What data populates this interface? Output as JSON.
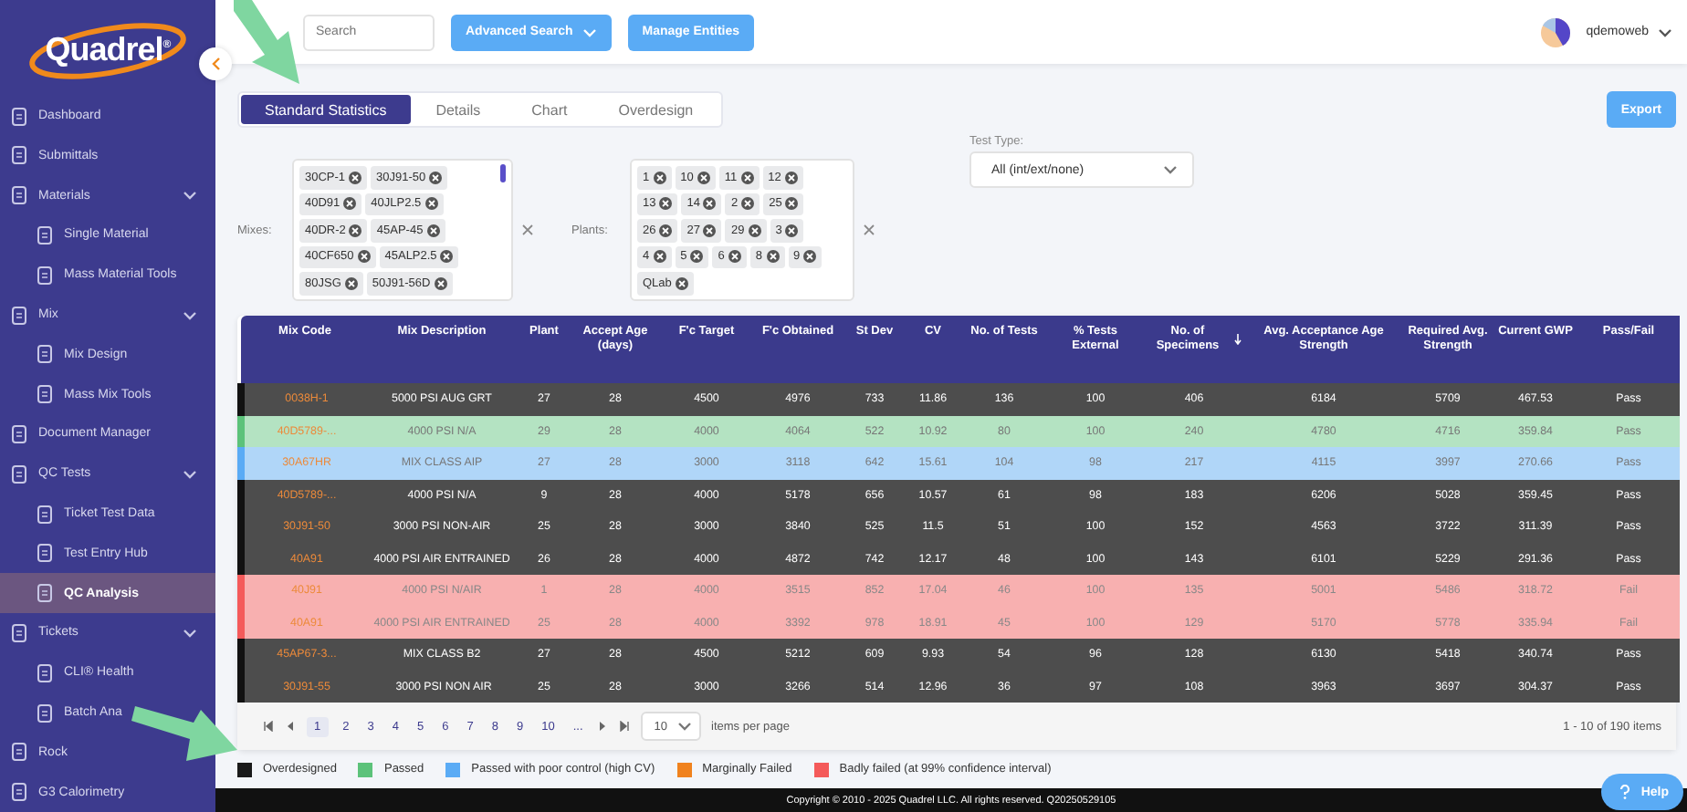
{
  "sidebar": {
    "logo": "Quadrel$^{®}$",
    "items": [
      {
        "label": "Dashboard",
        "selected": false
      },
      {
        "label": "Submittals",
        "selected": false
      },
      {
        "label": "Materials",
        "selected": false,
        "expanded": true,
        "children": [
          {
            "label": "Single Material",
            "selected": false
          },
          {
            "label": "Mass Material Tools",
            "selected": false
          }
        ]
      },
      {
        "label": "Mix",
        "selected": false,
        "expanded": true,
        "children": [
          {
            "label": "Mix Design",
            "selected": false
          },
          {
            "label": "Mass Mix Tools",
            "selected": false
          }
        ]
      },
      {
        "label": "Document Manager",
        "selected": false
      },
      {
        "label": "QC Tests",
        "selected": false,
        "expanded": true,
        "children": [
          {
            "label": "Ticket Test Data",
            "selected": false
          },
          {
            "label": "Test Entry Hub",
            "selected": false
          },
          {
            "label": "QC Analysis",
            "selected": true
          }
        ]
      },
      {
        "label": "Tickets",
        "selected": false,
        "expanded": true,
        "children": [
          {
            "label": "CLI® Health",
            "selected": false
          },
          {
            "label": "Batch Ana",
            "selected": false
          }
        ]
      },
      {
        "label": "Rock",
        "selected": false
      },
      {
        "label": "G3 Calorimetry",
        "selected": false
      }
    ]
  },
  "topbar": {
    "search": {
      "placeholder": "Search"
    },
    "buttons": [
      {
        "label": "Advanced Search",
        "kind": "dropdown"
      },
      {
        "label": "Manage Entities",
        "kind": "plain"
      }
    ],
    "user": "qdemoweb"
  },
  "tabs": [
    {
      "label": "Standard Statistics",
      "selected": true
    },
    {
      "label": "Details",
      "selected": false
    },
    {
      "label": "Chart",
      "selected": false
    },
    {
      "label": "Overdesign",
      "selected": false
    }
  ],
  "export_button": "Export",
  "filters": {
    "mixes": {
      "label": "Mixes:",
      "chips": [
        "30CP-1",
        "30J91-50",
        "40D91",
        "40JLP2.5",
        "40DR-2",
        "45AP-45",
        "40CF650",
        "45ALP2.5",
        "80JSG",
        "50J91-56D"
      ]
    },
    "plants": {
      "label": "Plants:",
      "chips": [
        "1",
        "10",
        "11",
        "12",
        "13",
        "14",
        "2",
        "25",
        "26",
        "27",
        "29",
        "3",
        "4",
        "5",
        "6",
        "8",
        "9",
        "QLab"
      ]
    },
    "test_type": {
      "label": "Test Type:",
      "value": "All (int/ext/none)"
    }
  },
  "table": {
    "columns": [
      {
        "label": "Mix Code",
        "sorted": false
      },
      {
        "label": "Mix Description",
        "sorted": false
      },
      {
        "label": "Plant",
        "sorted": false
      },
      {
        "label": "Accept Age (days)",
        "sorted": false
      },
      {
        "label": "F'c Target",
        "sorted": false
      },
      {
        "label": "F'c Obtained",
        "sorted": false
      },
      {
        "label": "St Dev",
        "sorted": false
      },
      {
        "label": "CV",
        "sorted": false
      },
      {
        "label": "No. of Tests",
        "sorted": false
      },
      {
        "label": "% Tests External",
        "sorted": false
      },
      {
        "label": "No. of Specimens",
        "sorted": true
      },
      {
        "label": "Avg. Acceptance Age Strength",
        "sorted": false
      },
      {
        "label": "Required Avg. Strength",
        "sorted": false
      },
      {
        "label": "Current GWP",
        "sorted": false
      },
      {
        "label": "Pass/Fail",
        "sorted": false
      }
    ],
    "rows": [
      {
        "kind": "overdesigned",
        "cells": [
          "0038H-1",
          "5000 PSI AUG GRT",
          "27",
          "28",
          "4500",
          "4976",
          "733",
          "11.86",
          "136",
          "100",
          "406",
          "6184",
          "5709",
          "467.53",
          "Pass"
        ]
      },
      {
        "kind": "passed",
        "cells": [
          "40D5789-...",
          "4000 PSI N/A",
          "29",
          "28",
          "4000",
          "4064",
          "522",
          "10.92",
          "80",
          "100",
          "240",
          "4780",
          "4716",
          "359.84",
          "Pass"
        ]
      },
      {
        "kind": "poor_control",
        "cells": [
          "30A67HR",
          "MIX CLASS AIP",
          "27",
          "28",
          "3000",
          "3118",
          "642",
          "15.61",
          "104",
          "98",
          "217",
          "4115",
          "3997",
          "270.66",
          "Pass"
        ]
      },
      {
        "kind": "overdesigned",
        "cells": [
          "40D5789-...",
          "4000 PSI N/A",
          "9",
          "28",
          "4000",
          "5178",
          "656",
          "10.57",
          "61",
          "98",
          "183",
          "6206",
          "5028",
          "359.45",
          "Pass"
        ]
      },
      {
        "kind": "overdesigned",
        "cells": [
          "30J91-50",
          "3000 PSI NON-AIR",
          "25",
          "28",
          "3000",
          "3840",
          "525",
          "11.5",
          "51",
          "100",
          "152",
          "4563",
          "3722",
          "311.39",
          "Pass"
        ]
      },
      {
        "kind": "overdesigned",
        "cells": [
          "40A91",
          "4000 PSI AIR ENTRAINED",
          "26",
          "28",
          "4000",
          "4872",
          "742",
          "12.17",
          "48",
          "100",
          "143",
          "6101",
          "5229",
          "291.36",
          "Pass"
        ]
      },
      {
        "kind": "badly_failed",
        "cells": [
          "40J91",
          "4000 PSI N/AIR",
          "1",
          "28",
          "4000",
          "3515",
          "852",
          "17.04",
          "46",
          "100",
          "135",
          "5001",
          "5486",
          "318.72",
          "Fail"
        ]
      },
      {
        "kind": "badly_failed",
        "cells": [
          "40A91",
          "4000 PSI AIR ENTRAINED",
          "25",
          "28",
          "4000",
          "3392",
          "978",
          "18.91",
          "45",
          "100",
          "129",
          "5170",
          "5778",
          "335.94",
          "Fail"
        ]
      },
      {
        "kind": "overdesigned",
        "cells": [
          "45AP67-3...",
          "MIX CLASS B2",
          "27",
          "28",
          "4500",
          "5212",
          "609",
          "9.93",
          "54",
          "96",
          "128",
          "6130",
          "5418",
          "340.74",
          "Pass"
        ]
      },
      {
        "kind": "overdesigned",
        "cells": [
          "30J91-55",
          "3000 PSI NON AIR",
          "25",
          "28",
          "3000",
          "3266",
          "514",
          "12.96",
          "36",
          "97",
          "108",
          "3963",
          "3697",
          "304.37",
          "Pass"
        ]
      }
    ]
  },
  "pager": {
    "pages": [
      {
        "label": "1",
        "selected": true
      },
      {
        "label": "2",
        "selected": false
      },
      {
        "label": "3",
        "selected": false
      },
      {
        "label": "4",
        "selected": false
      },
      {
        "label": "5",
        "selected": false
      },
      {
        "label": "6",
        "selected": false
      },
      {
        "label": "7",
        "selected": false
      },
      {
        "label": "8",
        "selected": false
      },
      {
        "label": "9",
        "selected": false
      },
      {
        "label": "10",
        "selected": false
      },
      {
        "label": "...",
        "selected": false
      }
    ],
    "page_size": "10",
    "page_size_label": "items per page",
    "summary": "1 - 10 of 190 items"
  },
  "legend": [
    {
      "label": "Overdesigned",
      "color": "#1a1a1a"
    },
    {
      "label": "Passed",
      "color": "#5cc27a"
    },
    {
      "label": "Passed with poor control (high CV)",
      "color": "#5aabf5"
    },
    {
      "label": "Marginally Failed",
      "color": "#f0821e"
    },
    {
      "label": "Badly failed (at 99% confidence interval)",
      "color": "#f45a5a"
    }
  ],
  "footer": "Copyright © 2010 - 2025 Quadrel LLC. All rights reserved. Q20250529105",
  "help_button": "Help"
}
